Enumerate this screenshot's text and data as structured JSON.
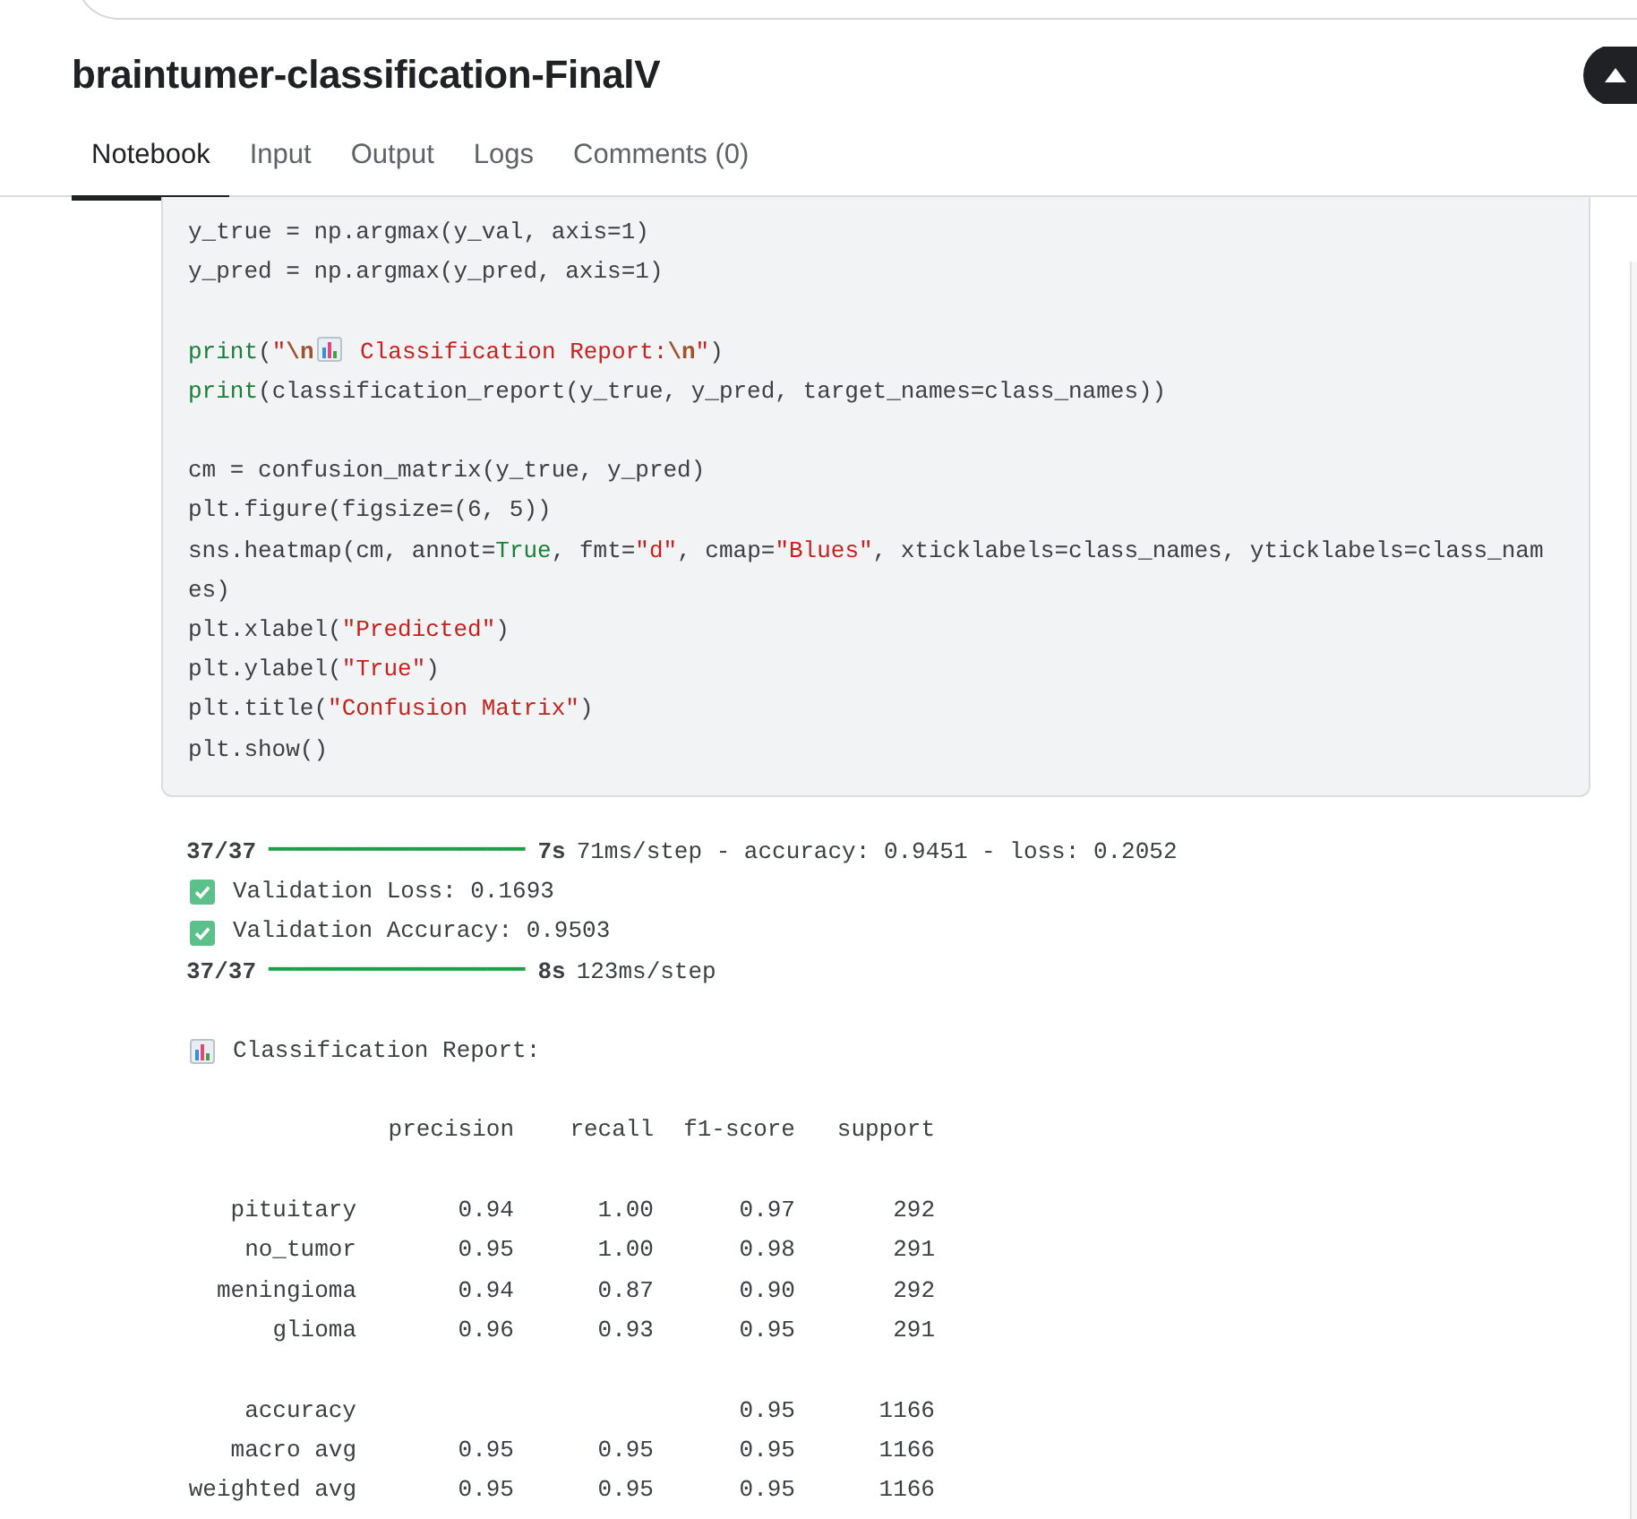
{
  "title": "braintumer-classification-FinalV",
  "tabs": [
    {
      "label": "Notebook",
      "selected": true
    },
    {
      "label": "Input",
      "selected": false
    },
    {
      "label": "Output",
      "selected": false
    },
    {
      "label": "Logs",
      "selected": false
    },
    {
      "label": "Comments (0)",
      "selected": false
    }
  ],
  "code_lines": [
    {
      "kind": "code",
      "tokens": [
        {
          "kind": "plain",
          "text": "y_true = np.argmax(y_val, axis=1)"
        }
      ]
    },
    {
      "kind": "code",
      "tokens": [
        {
          "kind": "plain",
          "text": "y_pred = np.argmax(y_pred, axis=1)"
        }
      ]
    },
    {
      "kind": "blank"
    },
    {
      "kind": "code",
      "tokens": [
        {
          "kind": "builtin",
          "text": "print"
        },
        {
          "kind": "plain",
          "text": "("
        },
        {
          "kind": "string",
          "text": "\""
        },
        {
          "kind": "escape",
          "text": "\\n"
        },
        {
          "kind": "icon"
        },
        {
          "kind": "string",
          "text": " Classification Report:"
        },
        {
          "kind": "escape",
          "text": "\\n"
        },
        {
          "kind": "string",
          "text": "\""
        },
        {
          "kind": "plain",
          "text": ")"
        }
      ]
    },
    {
      "kind": "code",
      "tokens": [
        {
          "kind": "builtin",
          "text": "print"
        },
        {
          "kind": "plain",
          "text": "(classification_report(y_true, y_pred, target_names=class_names))"
        }
      ]
    },
    {
      "kind": "blank"
    },
    {
      "kind": "code",
      "tokens": [
        {
          "kind": "plain",
          "text": "cm = confusion_matrix(y_true, y_pred)"
        }
      ]
    },
    {
      "kind": "code",
      "tokens": [
        {
          "kind": "plain",
          "text": "plt.figure(figsize=(6, 5))"
        }
      ]
    },
    {
      "kind": "code",
      "tokens": [
        {
          "kind": "plain",
          "text": "sns.heatmap(cm, annot="
        },
        {
          "kind": "constant",
          "text": "True"
        },
        {
          "kind": "plain",
          "text": ", fmt="
        },
        {
          "kind": "string",
          "text": "\"d\""
        },
        {
          "kind": "plain",
          "text": ", cmap="
        },
        {
          "kind": "string",
          "text": "\"Blues\""
        },
        {
          "kind": "plain",
          "text": ", xticklabels=class_names, yticklabels=class_nam"
        }
      ]
    },
    {
      "kind": "code",
      "tokens": [
        {
          "kind": "plain",
          "text": "es)"
        }
      ]
    },
    {
      "kind": "code",
      "tokens": [
        {
          "kind": "plain",
          "text": "plt.xlabel("
        },
        {
          "kind": "string",
          "text": "\"Predicted\""
        },
        {
          "kind": "plain",
          "text": ")"
        }
      ]
    },
    {
      "kind": "code",
      "tokens": [
        {
          "kind": "plain",
          "text": "plt.ylabel("
        },
        {
          "kind": "string",
          "text": "\"True\""
        },
        {
          "kind": "plain",
          "text": ")"
        }
      ]
    },
    {
      "kind": "code",
      "tokens": [
        {
          "kind": "plain",
          "text": "plt.title("
        },
        {
          "kind": "string",
          "text": "\"Confusion Matrix\""
        },
        {
          "kind": "plain",
          "text": ")"
        }
      ]
    },
    {
      "kind": "code",
      "tokens": [
        {
          "kind": "plain",
          "text": "plt.show()"
        }
      ]
    }
  ],
  "output_lines": [
    {
      "kind": "progress",
      "steps": "37/37",
      "bar": "━━━━━━━━━━━━━━━━━━━━",
      "time": "7s",
      "rest": "71ms/step - accuracy: 0.9451 - loss: 0.2052"
    },
    {
      "kind": "check",
      "text": "Validation Loss: 0.1693"
    },
    {
      "kind": "check",
      "text": "Validation Accuracy: 0.9503"
    },
    {
      "kind": "progress",
      "steps": "37/37",
      "bar": "━━━━━━━━━━━━━━━━━━━━",
      "time": "8s",
      "rest": "123ms/step"
    },
    {
      "kind": "blank"
    },
    {
      "kind": "chart",
      "text": "Classification Report:"
    },
    {
      "kind": "blank"
    }
  ],
  "report": {
    "columns": [
      "precision",
      "recall",
      "f1-score",
      "support"
    ],
    "groups": [
      [
        {
          "label": "pituitary",
          "precision": "0.94",
          "recall": "1.00",
          "f1": "0.97",
          "support": "292"
        },
        {
          "label": "no_tumor",
          "precision": "0.95",
          "recall": "1.00",
          "f1": "0.98",
          "support": "291"
        },
        {
          "label": "meningioma",
          "precision": "0.94",
          "recall": "0.87",
          "f1": "0.90",
          "support": "292"
        },
        {
          "label": "glioma",
          "precision": "0.96",
          "recall": "0.93",
          "f1": "0.95",
          "support": "291"
        }
      ],
      [
        {
          "label": "accuracy",
          "f1": "0.95",
          "support": "1166"
        },
        {
          "label": "macro avg",
          "precision": "0.95",
          "recall": "0.95",
          "f1": "0.95",
          "support": "1166"
        },
        {
          "label": "weighted avg",
          "precision": "0.95",
          "recall": "0.95",
          "f1": "0.95",
          "support": "1166"
        }
      ]
    ]
  }
}
